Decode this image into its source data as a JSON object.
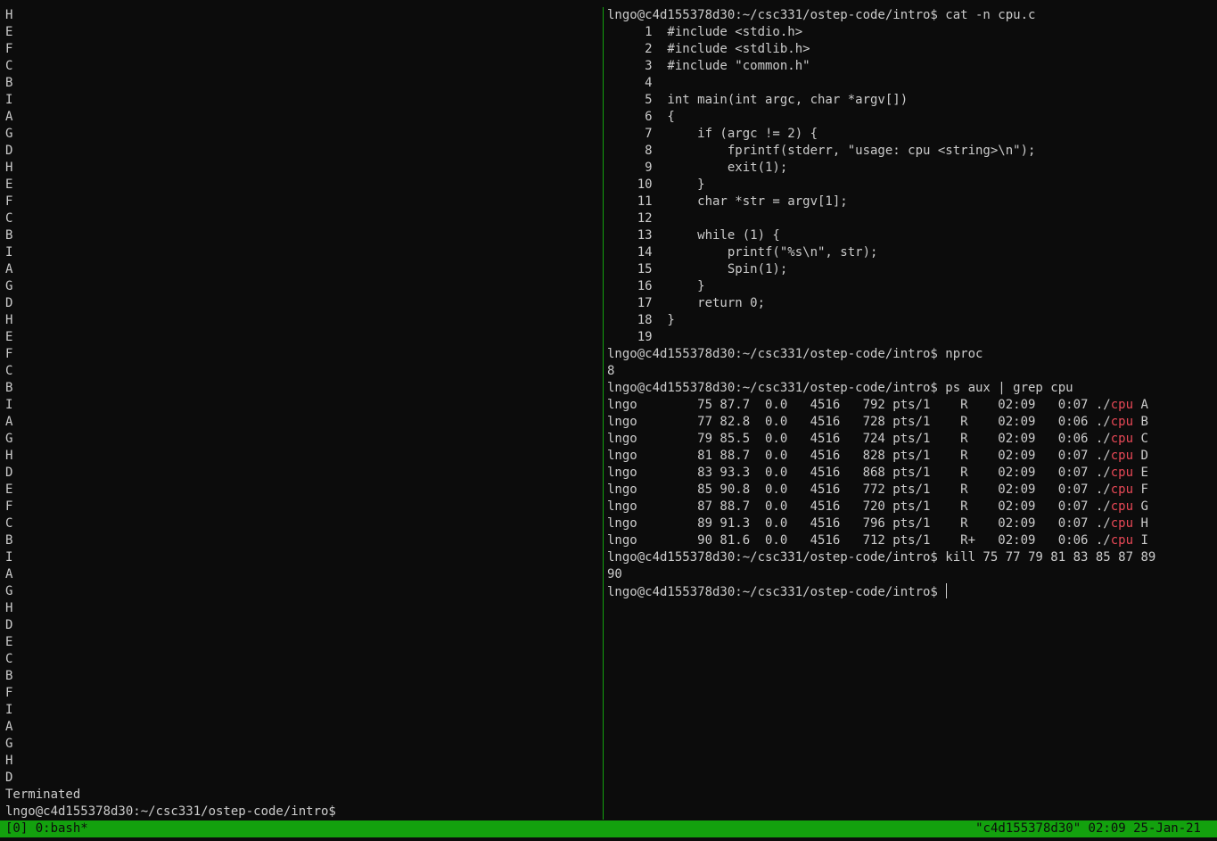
{
  "left_pane": {
    "lines": [
      "H",
      "E",
      "F",
      "C",
      "B",
      "I",
      "A",
      "G",
      "D",
      "H",
      "E",
      "F",
      "C",
      "B",
      "I",
      "A",
      "G",
      "D",
      "H",
      "E",
      "F",
      "C",
      "B",
      "I",
      "A",
      "G",
      "H",
      "D",
      "E",
      "F",
      "C",
      "B",
      "I",
      "A",
      "G",
      "H",
      "D",
      "E",
      "C",
      "B",
      "F",
      "I",
      "A",
      "G",
      "H",
      "D",
      "Terminated",
      "lngo@c4d155378d30:~/csc331/ostep-code/intro$"
    ]
  },
  "right_pane": {
    "lines": [
      "lngo@c4d155378d30:~/csc331/ostep-code/intro$ cat -n cpu.c",
      "     1  #include <stdio.h>",
      "     2  #include <stdlib.h>",
      "     3  #include \"common.h\"",
      "     4",
      "     5  int main(int argc, char *argv[])",
      "     6  {",
      "     7      if (argc != 2) {",
      "     8          fprintf(stderr, \"usage: cpu <string>\\n\");",
      "     9          exit(1);",
      "    10      }",
      "    11      char *str = argv[1];",
      "    12",
      "    13      while (1) {",
      "    14          printf(\"%s\\n\", str);",
      "    15          Spin(1);",
      "    16      }",
      "    17      return 0;",
      "    18  }",
      "    19",
      "lngo@c4d155378d30:~/csc331/ostep-code/intro$ nproc",
      "8",
      "lngo@c4d155378d30:~/csc331/ostep-code/intro$ ps aux | grep cpu"
    ],
    "ps_rows": [
      {
        "pre": "lngo        75 87.7  0.0   4516   792 pts/1    R    02:09   0:07 ./",
        "hl": "cpu",
        "post": " A"
      },
      {
        "pre": "lngo        77 82.8  0.0   4516   728 pts/1    R    02:09   0:06 ./",
        "hl": "cpu",
        "post": " B"
      },
      {
        "pre": "lngo        79 85.5  0.0   4516   724 pts/1    R    02:09   0:06 ./",
        "hl": "cpu",
        "post": " C"
      },
      {
        "pre": "lngo        81 88.7  0.0   4516   828 pts/1    R    02:09   0:07 ./",
        "hl": "cpu",
        "post": " D"
      },
      {
        "pre": "lngo        83 93.3  0.0   4516   868 pts/1    R    02:09   0:07 ./",
        "hl": "cpu",
        "post": " E"
      },
      {
        "pre": "lngo        85 90.8  0.0   4516   772 pts/1    R    02:09   0:07 ./",
        "hl": "cpu",
        "post": " F"
      },
      {
        "pre": "lngo        87 88.7  0.0   4516   720 pts/1    R    02:09   0:07 ./",
        "hl": "cpu",
        "post": " G"
      },
      {
        "pre": "lngo        89 91.3  0.0   4516   796 pts/1    R    02:09   0:07 ./",
        "hl": "cpu",
        "post": " H"
      },
      {
        "pre": "lngo        90 81.6  0.0   4516   712 pts/1    R+   02:09   0:06 ./",
        "hl": "cpu",
        "post": " I"
      }
    ],
    "after_lines": [
      "lngo@c4d155378d30:~/csc331/ostep-code/intro$ kill 75 77 79 81 83 85 87 89",
      "90"
    ],
    "prompt": "lngo@c4d155378d30:~/csc331/ostep-code/intro$ "
  },
  "status_bar": {
    "left": "[0] 0:bash*",
    "right": "\"c4d155378d30\" 02:09 25-Jan-21"
  },
  "colors": {
    "background": "#0c0c0c",
    "foreground": "#cccccc",
    "accent_green": "#13a10e",
    "highlight_red": "#e74856"
  }
}
